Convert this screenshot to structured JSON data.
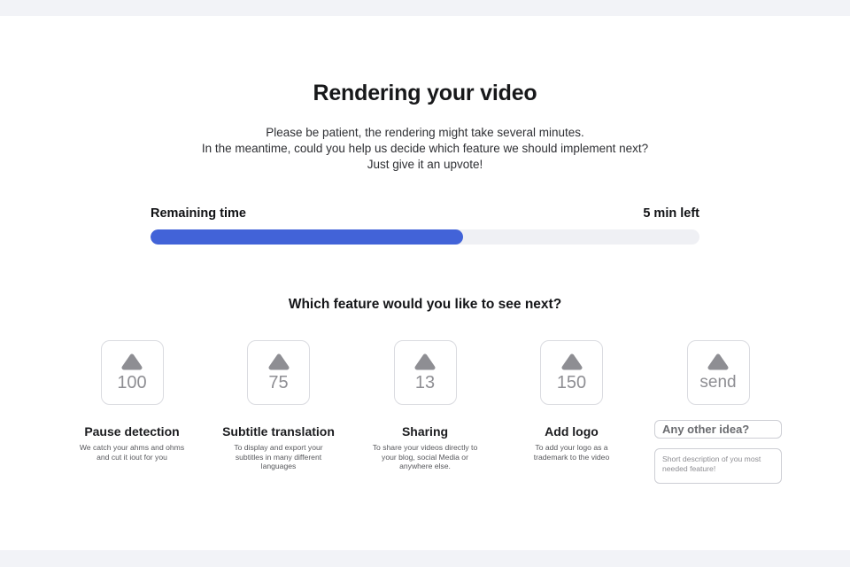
{
  "page": {
    "title": "Rendering your video",
    "subtitle": "Please be patient, the rendering might take several minutes.\nIn the meantime, could you help us decide which feature we should implement next?\nJust give it an upvote!"
  },
  "progress": {
    "label": "Remaining time",
    "time_left": "5 min left",
    "percent": 57,
    "fill_color": "#4263d8",
    "track_color": "#eff0f4"
  },
  "features": {
    "heading": "Which feature would you like to see next?",
    "items": [
      {
        "votes": "100",
        "title": "Pause detection",
        "description": "We catch your ahms and ohms and cut it iout for you"
      },
      {
        "votes": "75",
        "title": "Subtitle translation",
        "description": "To display and export your subtitles in many different languages"
      },
      {
        "votes": "13",
        "title": "Sharing",
        "description": "To share your videos directly to your blog, social Media or anywhere else."
      },
      {
        "votes": "150",
        "title": "Add logo",
        "description": "To add your logo as a trademark to the video"
      }
    ],
    "custom": {
      "send_label": "send",
      "idea_placeholder": "Any other idea?",
      "description_placeholder": "Short description of you most needed feature!"
    }
  },
  "colors": {
    "accent_blue": "#4263d8",
    "muted_gray": "#8e8e93",
    "frame_background": "#f2f3f7"
  }
}
